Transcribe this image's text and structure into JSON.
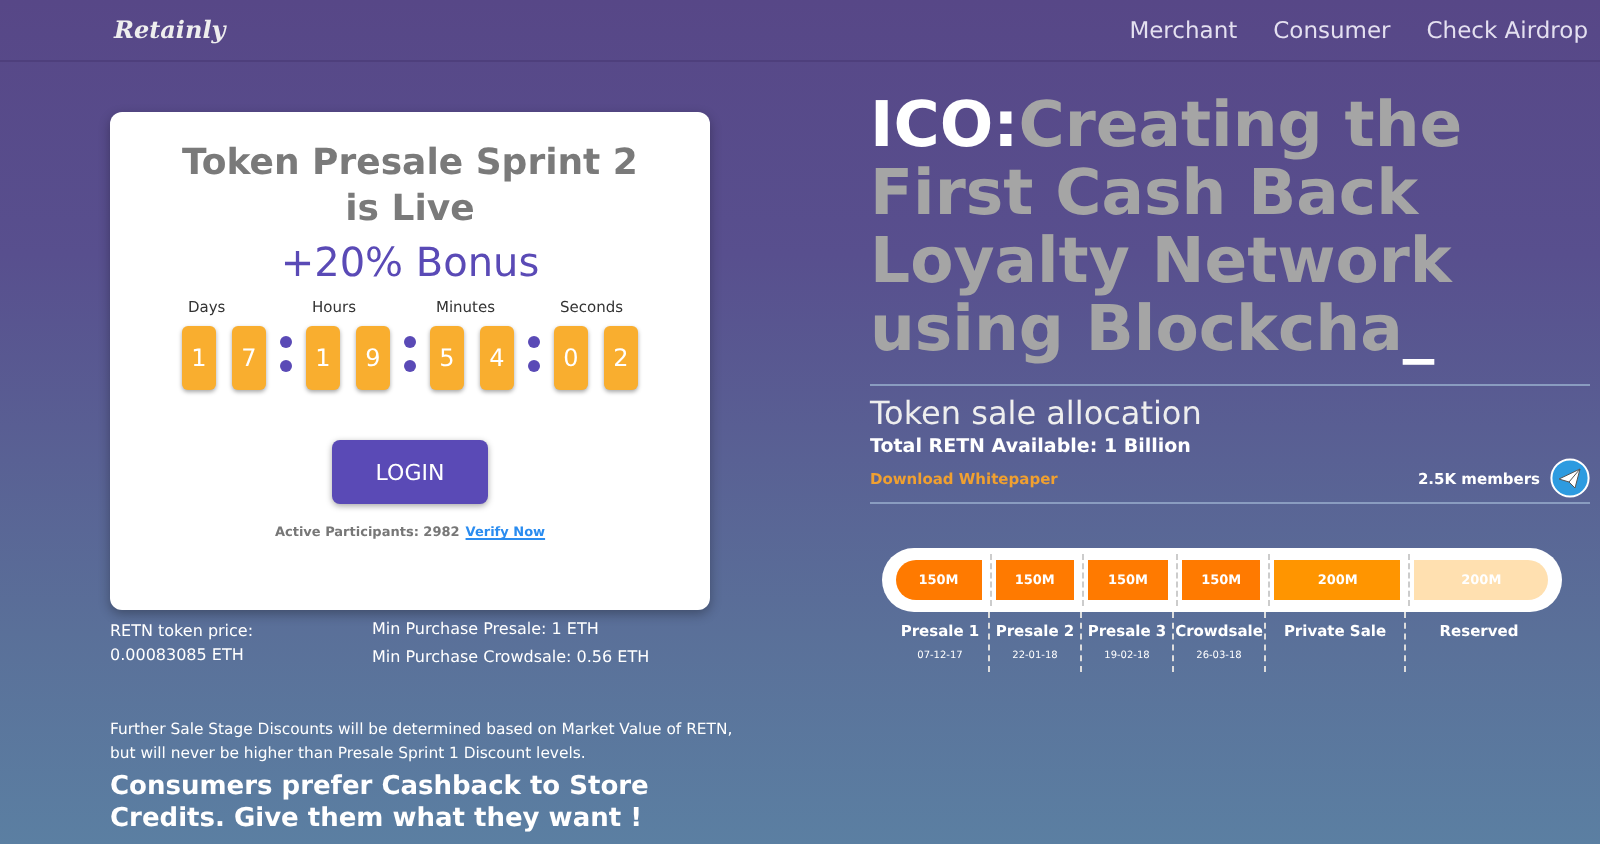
{
  "header": {
    "logo": "Retainly",
    "nav": [
      "Merchant",
      "Consumer",
      "Check Airdrop"
    ]
  },
  "presale_card": {
    "title": "Token Presale Sprint 2 is Live",
    "bonus": "+20% Bonus",
    "countdown": [
      {
        "label": "Days",
        "digits": [
          "1",
          "7"
        ]
      },
      {
        "label": "Hours",
        "digits": [
          "1",
          "9"
        ]
      },
      {
        "label": "Minutes",
        "digits": [
          "5",
          "4"
        ]
      },
      {
        "label": "Seconds",
        "digits": [
          "0",
          "2"
        ]
      }
    ],
    "login_button": "LOGIN",
    "participants": "Active Participants: 2982",
    "verify_link": "Verify Now"
  },
  "price": {
    "label": "RETN token price:",
    "value": "0.00083085 ETH"
  },
  "min_purchase": [
    "Min Purchase Presale: 1 ETH",
    "Min Purchase Crowdsale: 0.56 ETH"
  ],
  "note": "Further Sale Stage Discounts will be determined based on Market Value of RETN, but will never be higher than Presale Sprint 1 Discount levels.",
  "slogan": "Consumers prefer Cashback to Store Credits. Give them what they want !",
  "headline": {
    "prefix": "ICO:",
    "text": "Creating the First Cash Back Loyalty Network using Blockcha",
    "cursor": "_"
  },
  "allocation": {
    "title": "Token sale allocation",
    "total": "Total RETN Available: 1 Billion",
    "whitepaper_link": "Download Whitepaper",
    "members": "2.5K members",
    "stages": [
      {
        "amount": "150M",
        "name": "Presale 1",
        "date": "07-12-17",
        "color": "#ff7a00"
      },
      {
        "amount": "150M",
        "name": "Presale 2",
        "date": "22-01-18",
        "color": "#ff7a00"
      },
      {
        "amount": "150M",
        "name": "Presale 3",
        "date": "19-02-18",
        "color": "#ff7a00"
      },
      {
        "amount": "150M",
        "name": "Crowdsale",
        "date": "26-03-18",
        "color": "#ff7a00"
      },
      {
        "amount": "200M",
        "name": "Private Sale",
        "color": "#ff9500"
      },
      {
        "amount": "200M",
        "name": "Reserved",
        "color": "#ffe0b0"
      }
    ]
  }
}
